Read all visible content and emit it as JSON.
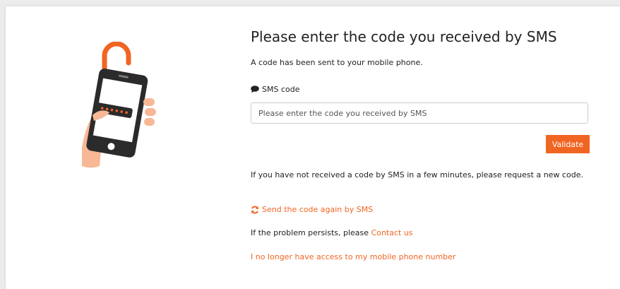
{
  "main": {
    "title": "Please enter the code you received by SMS",
    "subtitle": "A code has been sent to your mobile phone.",
    "sms_label": "SMS code",
    "sms_label_icon": "speech-bubble-icon",
    "input_placeholder": "Please enter the code you received by SMS",
    "validate_label": "Validate",
    "info_text": "If you have not received a code by SMS in a few minutes, please request a new code.",
    "resend_icon": "refresh-icon",
    "resend_label": "Send the code again by SMS",
    "persist_text": "If the problem persists, please ",
    "contact_label": "Contact us",
    "no_access_label": "I no longer have access to my mobile phone number"
  },
  "illustration": {
    "icon": "phone-unlock-icon"
  },
  "colors": {
    "accent": "#f16522",
    "text": "#222222",
    "background": "#ececec",
    "card": "#ffffff"
  }
}
